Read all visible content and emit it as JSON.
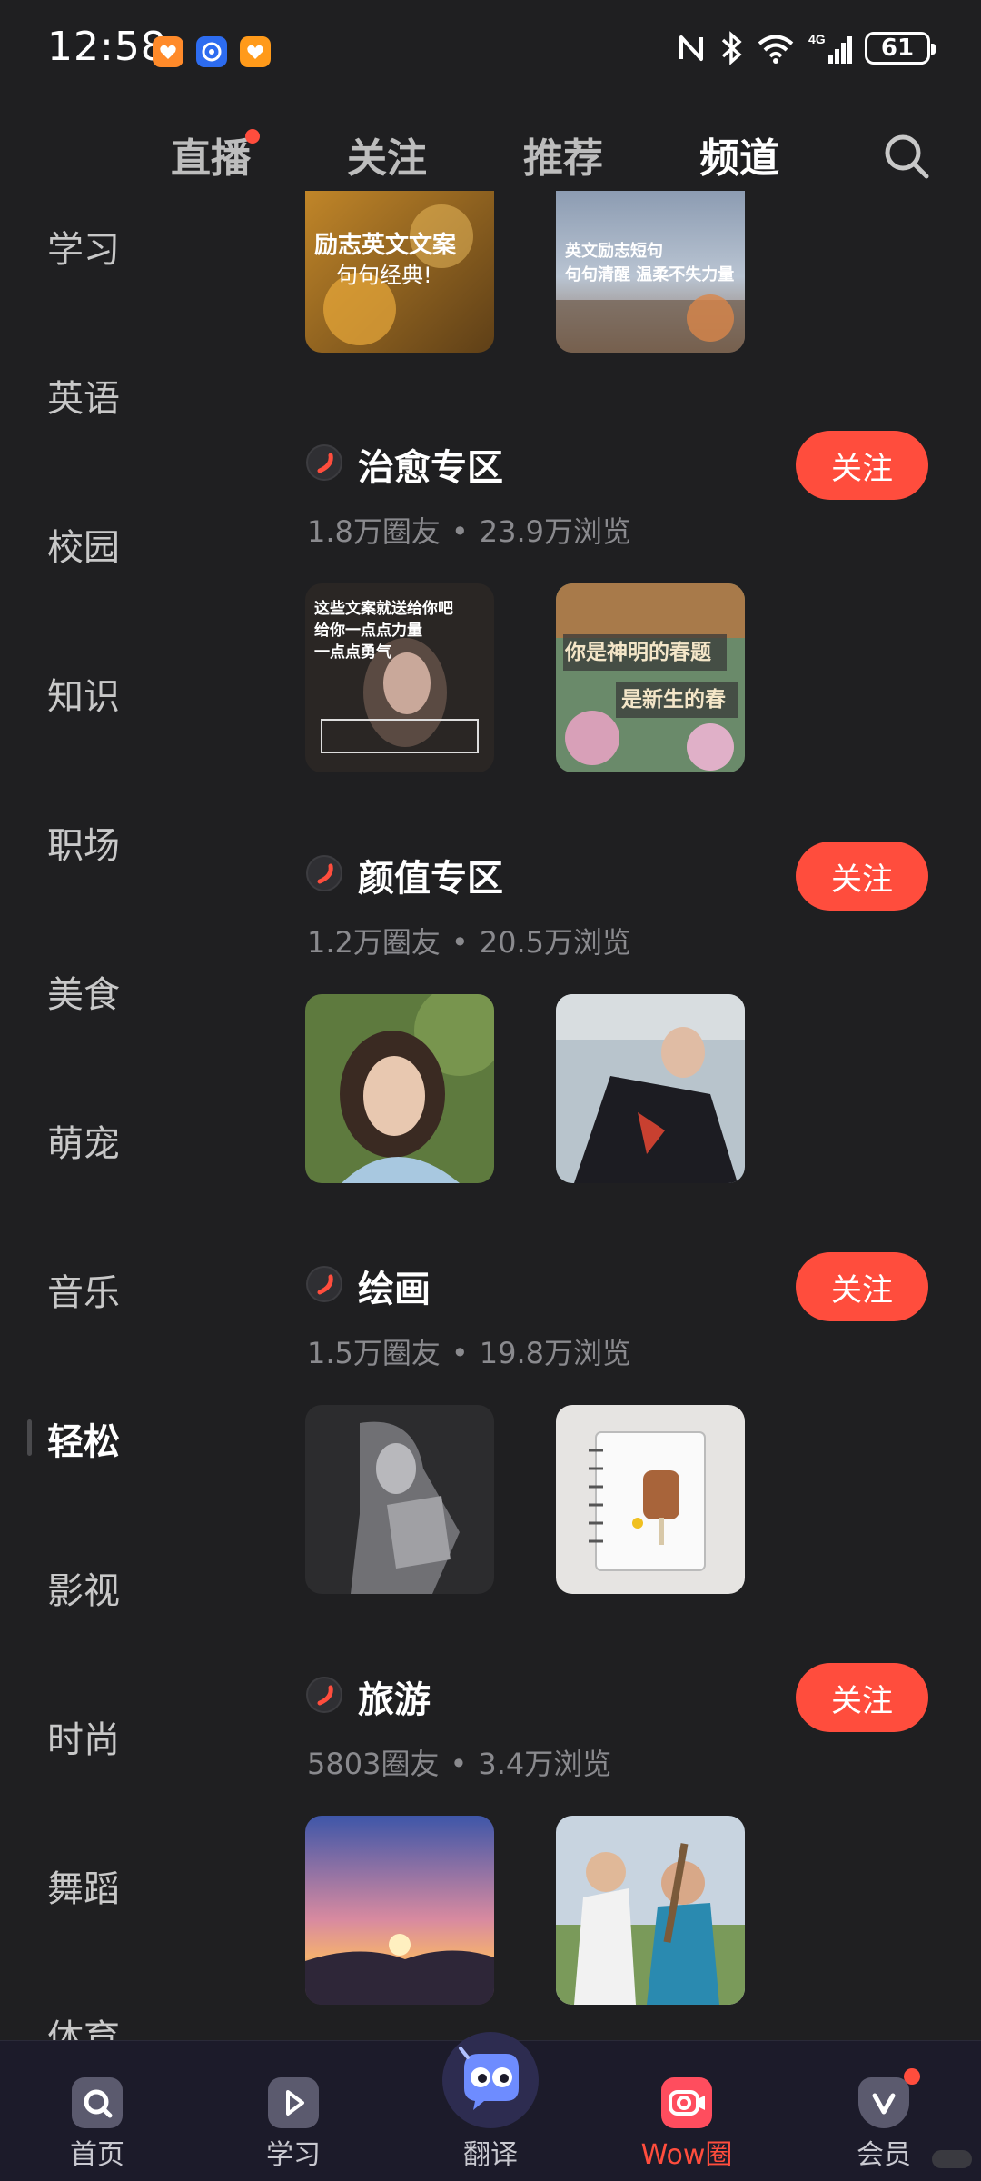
{
  "status_bar": {
    "time": "12:58",
    "battery": "61",
    "network": "4G"
  },
  "top_tabs": [
    {
      "label": "直播",
      "has_dot": true
    },
    {
      "label": "关注"
    },
    {
      "label": "推荐"
    },
    {
      "label": "频道",
      "active": true
    }
  ],
  "sidebar": {
    "items": [
      "学习",
      "英语",
      "校园",
      "知识",
      "职场",
      "美食",
      "萌宠",
      "音乐",
      "轻松",
      "影视",
      "时尚",
      "舞蹈",
      "体育"
    ],
    "active": "轻松"
  },
  "top_thumbs": [
    {
      "text_line1": "励志英文文案",
      "text_line2": "句句经典!"
    },
    {
      "text_line1": "英文励志短句",
      "text_line2": "句句清醒 温柔不失力量"
    }
  ],
  "channels": [
    {
      "name": "治愈专区",
      "members": "1.8万圈友",
      "separator": "•",
      "views": "23.9万浏览",
      "follow_label": "关注",
      "thumb_texts": [
        {
          "l1": "这些文案就送给你吧",
          "l2": "给你一点点力量",
          "l3": "一点点勇气"
        },
        {
          "l1": "你是神明的春题",
          "l2": "是新生的春"
        }
      ]
    },
    {
      "name": "颜值专区",
      "members": "1.2万圈友",
      "separator": "•",
      "views": "20.5万浏览",
      "follow_label": "关注"
    },
    {
      "name": "绘画",
      "members": "1.5万圈友",
      "separator": "•",
      "views": "19.8万浏览",
      "follow_label": "关注"
    },
    {
      "name": "旅游",
      "members": "5803圈友",
      "separator": "•",
      "views": "3.4万浏览",
      "follow_label": "关注"
    }
  ],
  "bottom_nav": [
    {
      "label": "首页",
      "icon": "home-search-icon"
    },
    {
      "label": "学习",
      "icon": "play-icon"
    },
    {
      "label": "翻译",
      "icon": "translate-mascot-icon"
    },
    {
      "label": "Wow圈",
      "icon": "camera-icon",
      "active": true
    },
    {
      "label": "会员",
      "icon": "vip-icon",
      "has_dot": true
    }
  ],
  "colors": {
    "background": "#1f1f21",
    "accent": "#ff4d3d",
    "muted_text": "#8a8a8e",
    "nav_background": "#1c1b2a"
  }
}
